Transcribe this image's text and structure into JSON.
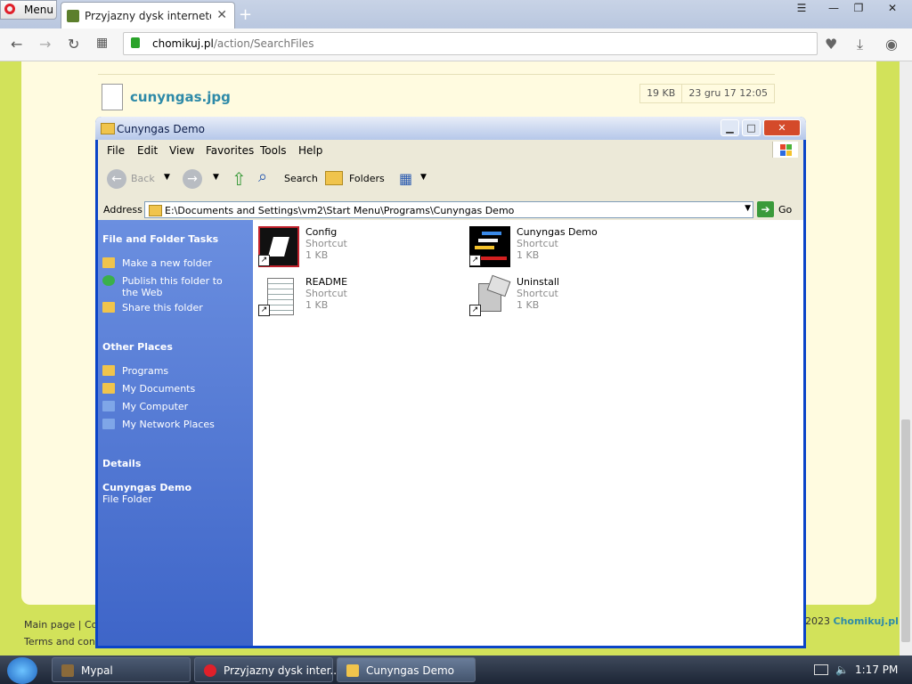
{
  "browser": {
    "menu_label": "Menu",
    "tab_title": "Przyjazny dysk internetowy",
    "url_domain": "chomikuj.pl",
    "url_path": "/action/SearchFiles"
  },
  "web": {
    "file_name": "cunyngas.jpg",
    "file_size": "19 KB",
    "file_date": "23 gru 17 12:05",
    "footer_link1": "Main page",
    "footer_link1b": "Co",
    "footer_link2": "Terms and cond",
    "footer_year": "2023",
    "footer_brand": "Chomikuj.pl"
  },
  "window": {
    "title": "Cunyngas Demo",
    "menus": [
      "File",
      "Edit",
      "View",
      "Favorites",
      "Tools",
      "Help"
    ],
    "toolbar": {
      "back": "Back",
      "search": "Search",
      "folders": "Folders"
    },
    "address_label": "Address",
    "address_path": "E:\\Documents and Settings\\vm2\\Start Menu\\Programs\\Cunyngas Demo",
    "go_label": "Go"
  },
  "taskpane": {
    "file_tasks_title": "File and Folder Tasks",
    "file_tasks": [
      "Make a new folder",
      "Publish this folder to the Web",
      "Share this folder"
    ],
    "other_places_title": "Other Places",
    "other_places": [
      "Programs",
      "My Documents",
      "My Computer",
      "My Network Places"
    ],
    "details_title": "Details",
    "details_name": "Cunyngas Demo",
    "details_type": "File Folder"
  },
  "files": [
    {
      "name": "Config",
      "type": "Shortcut",
      "size": "1 KB"
    },
    {
      "name": "Cunyngas Demo",
      "type": "Shortcut",
      "size": "1 KB"
    },
    {
      "name": "README",
      "type": "Shortcut",
      "size": "1 KB"
    },
    {
      "name": "Uninstall",
      "type": "Shortcut",
      "size": "1 KB"
    }
  ],
  "taskbar": {
    "items": [
      "Mypal",
      "Przyjazny dysk inter...",
      "Cunyngas Demo"
    ],
    "clock": "1:17 PM"
  },
  "colors": {
    "page_bg": "#d2e25a",
    "xp_blue": "#0a44c8",
    "link": "#2e8aa8"
  }
}
